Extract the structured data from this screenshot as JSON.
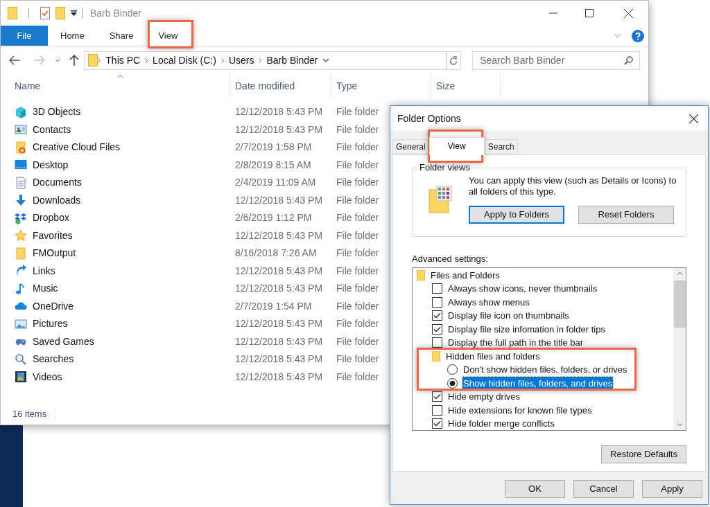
{
  "explorer": {
    "title": "Barb Binder",
    "ribbon_tabs": [
      {
        "label": "File",
        "kind": "file"
      },
      {
        "label": "Home",
        "kind": "tab"
      },
      {
        "label": "Share",
        "kind": "tab"
      },
      {
        "label": "View",
        "kind": "tab"
      }
    ],
    "address": [
      "This PC",
      "Local Disk (C:)",
      "Users",
      "Barb Binder"
    ],
    "search": {
      "placeholder": "Search Barb Binder"
    },
    "columns": [
      "Name",
      "Date modified",
      "Type",
      "Size"
    ],
    "rows": [
      {
        "name": "3D Objects",
        "date": "12/12/2018 5:43 PM",
        "type": "File folder"
      },
      {
        "name": "Contacts",
        "date": "12/12/2018 5:43 PM",
        "type": "File folder"
      },
      {
        "name": "Creative Cloud Files",
        "date": "2/7/2019 1:58 PM",
        "type": "File folder"
      },
      {
        "name": "Desktop",
        "date": "2/8/2019 8:15 AM",
        "type": "File folder"
      },
      {
        "name": "Documents",
        "date": "2/4/2019 11:09 AM",
        "type": "File folder"
      },
      {
        "name": "Downloads",
        "date": "12/12/2018 5:43 PM",
        "type": "File folder"
      },
      {
        "name": "Dropbox",
        "date": "2/6/2019 1:12 PM",
        "type": "File folder"
      },
      {
        "name": "Favorites",
        "date": "12/12/2018 5:43 PM",
        "type": "File folder"
      },
      {
        "name": "FMOutput",
        "date": "8/16/2018 7:26 AM",
        "type": "File folder"
      },
      {
        "name": "Links",
        "date": "12/12/2018 5:43 PM",
        "type": "File folder"
      },
      {
        "name": "Music",
        "date": "12/12/2018 5:43 PM",
        "type": "File folder"
      },
      {
        "name": "OneDrive",
        "date": "2/7/2019 1:54 PM",
        "type": "File folder"
      },
      {
        "name": "Pictures",
        "date": "12/12/2018 5:43 PM",
        "type": "File folder"
      },
      {
        "name": "Saved Games",
        "date": "12/12/2018 5:43 PM",
        "type": "File folder"
      },
      {
        "name": "Searches",
        "date": "12/12/2018 5:43 PM",
        "type": "File folder"
      },
      {
        "name": "Videos",
        "date": "12/12/2018 5:43 PM",
        "type": "File folder"
      }
    ],
    "status_bar": "16 items"
  },
  "dialog": {
    "title": "Folder Options",
    "tabs": [
      {
        "label": "General",
        "selected": false
      },
      {
        "label": "View",
        "selected": true
      },
      {
        "label": "Search",
        "selected": false
      }
    ],
    "folder_views": {
      "legend": "Folder views",
      "text": "You can apply this view (such as Details or Icons) to all folders of this type.",
      "buttons": [
        "Apply to Folders",
        "Reset Folders"
      ]
    },
    "advanced_label": "Advanced settings:",
    "settings": [
      {
        "kind": "folder",
        "label": "Files and Folders",
        "children": [
          {
            "kind": "checkbox",
            "label": "Always show icons, never thumbnails",
            "checked": false,
            "selected": false
          },
          {
            "kind": "checkbox",
            "label": "Always show menus",
            "checked": false,
            "selected": false
          },
          {
            "kind": "checkbox",
            "label": "Display file icon on thumbnails",
            "checked": true,
            "selected": false
          },
          {
            "kind": "checkbox",
            "label": "Display file size infomation in folder tips",
            "checked": true,
            "selected": false
          },
          {
            "kind": "checkbox",
            "label": "Display the full path in the title bar",
            "checked": false,
            "selected": false
          },
          {
            "kind": "folder",
            "label": "Hidden files and folders",
            "children": [
              {
                "kind": "radio",
                "label": "Don't show hidden files, folders, or drives",
                "checked": false,
                "selected": false
              },
              {
                "kind": "radio",
                "label": "Show hidden files, folders, and drives",
                "checked": true,
                "selected": true
              }
            ]
          },
          {
            "kind": "checkbox",
            "label": "Hide empty drives",
            "checked": true,
            "selected": false
          },
          {
            "kind": "checkbox",
            "label": "Hide extensions for known file types",
            "checked": false,
            "selected": false
          },
          {
            "kind": "checkbox",
            "label": "Hide folder merge conflicts",
            "checked": true,
            "selected": false
          }
        ]
      }
    ],
    "restore_button": "Restore Defaults",
    "buttons": [
      "OK",
      "Cancel",
      "Apply"
    ]
  }
}
